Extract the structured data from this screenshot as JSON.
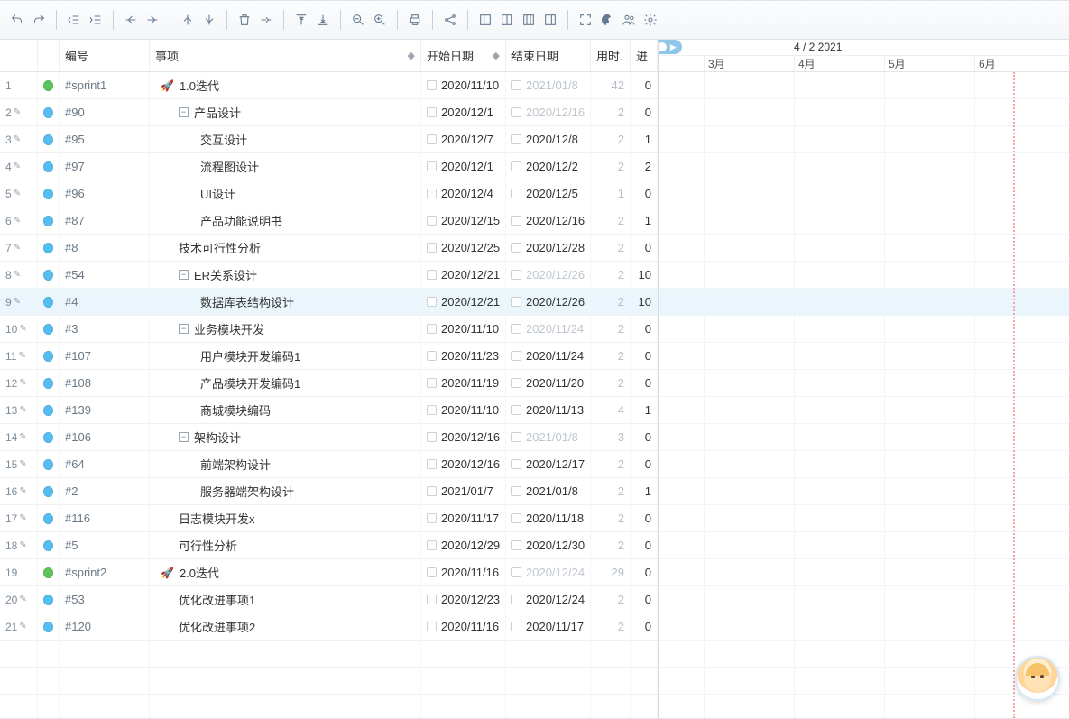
{
  "timeline": {
    "current_label": "4 / 2 2021",
    "months": [
      "3月",
      "4月",
      "5月",
      "6月"
    ]
  },
  "columns": {
    "num": "",
    "id": "编号",
    "name": "事项",
    "start": "开始日期",
    "end": "结束日期",
    "dur": "用时.",
    "prog": "进"
  },
  "rows": [
    {
      "n": "1",
      "edit": false,
      "dot": "green",
      "id": "#sprint1",
      "indent": 0,
      "icon": "rocket",
      "exp": null,
      "name": "1.0迭代",
      "start": "2020/11/10",
      "sFade": false,
      "end": "2021/01/8",
      "eFade": true,
      "dur": "42",
      "prog": "0"
    },
    {
      "n": "2",
      "edit": true,
      "dot": "blue",
      "id": "#90",
      "indent": 1,
      "icon": null,
      "exp": "-",
      "name": "产品设计",
      "start": "2020/12/1",
      "sFade": false,
      "end": "2020/12/16",
      "eFade": true,
      "dur": "2",
      "prog": "0"
    },
    {
      "n": "3",
      "edit": true,
      "dot": "blue",
      "id": "#95",
      "indent": 2,
      "icon": null,
      "exp": null,
      "name": "交互设计",
      "start": "2020/12/7",
      "sFade": false,
      "end": "2020/12/8",
      "eFade": false,
      "dur": "2",
      "prog": "1"
    },
    {
      "n": "4",
      "edit": true,
      "dot": "blue",
      "id": "#97",
      "indent": 2,
      "icon": null,
      "exp": null,
      "name": "流程图设计",
      "start": "2020/12/1",
      "sFade": false,
      "end": "2020/12/2",
      "eFade": false,
      "dur": "2",
      "prog": "2"
    },
    {
      "n": "5",
      "edit": true,
      "dot": "blue",
      "id": "#96",
      "indent": 2,
      "icon": null,
      "exp": null,
      "name": "UI设计",
      "start": "2020/12/4",
      "sFade": false,
      "end": "2020/12/5",
      "eFade": false,
      "dur": "1",
      "prog": "0"
    },
    {
      "n": "6",
      "edit": true,
      "dot": "blue",
      "id": "#87",
      "indent": 2,
      "icon": null,
      "exp": null,
      "name": "产品功能说明书",
      "start": "2020/12/15",
      "sFade": false,
      "end": "2020/12/16",
      "eFade": false,
      "dur": "2",
      "prog": "1"
    },
    {
      "n": "7",
      "edit": true,
      "dot": "blue",
      "id": "#8",
      "indent": 1,
      "icon": null,
      "exp": null,
      "name": "技术可行性分析",
      "start": "2020/12/25",
      "sFade": false,
      "end": "2020/12/28",
      "eFade": false,
      "dur": "2",
      "prog": "0"
    },
    {
      "n": "8",
      "edit": true,
      "dot": "blue",
      "id": "#54",
      "indent": 1,
      "icon": null,
      "exp": "-",
      "name": "ER关系设计",
      "start": "2020/12/21",
      "sFade": false,
      "end": "2020/12/26",
      "eFade": true,
      "dur": "2",
      "prog": "10"
    },
    {
      "n": "9",
      "edit": true,
      "dot": "blue",
      "id": "#4",
      "indent": 2,
      "icon": null,
      "exp": null,
      "name": "数据库表结构设计",
      "start": "2020/12/21",
      "sFade": false,
      "end": "2020/12/26",
      "eFade": false,
      "dur": "2",
      "prog": "10",
      "sel": true
    },
    {
      "n": "10",
      "edit": true,
      "dot": "blue",
      "id": "#3",
      "indent": 1,
      "icon": null,
      "exp": "-",
      "name": "业务模块开发",
      "start": "2020/11/10",
      "sFade": false,
      "end": "2020/11/24",
      "eFade": true,
      "dur": "2",
      "prog": "0"
    },
    {
      "n": "11",
      "edit": true,
      "dot": "blue",
      "id": "#107",
      "indent": 2,
      "icon": null,
      "exp": null,
      "name": "用户模块开发编码1",
      "start": "2020/11/23",
      "sFade": false,
      "end": "2020/11/24",
      "eFade": false,
      "dur": "2",
      "prog": "0"
    },
    {
      "n": "12",
      "edit": true,
      "dot": "blue",
      "id": "#108",
      "indent": 2,
      "icon": null,
      "exp": null,
      "name": "产品模块开发编码1",
      "start": "2020/11/19",
      "sFade": false,
      "end": "2020/11/20",
      "eFade": false,
      "dur": "2",
      "prog": "0"
    },
    {
      "n": "13",
      "edit": true,
      "dot": "blue",
      "id": "#139",
      "indent": 2,
      "icon": null,
      "exp": null,
      "name": "商城模块编码",
      "start": "2020/11/10",
      "sFade": false,
      "end": "2020/11/13",
      "eFade": false,
      "dur": "4",
      "prog": "1"
    },
    {
      "n": "14",
      "edit": true,
      "dot": "blue",
      "id": "#106",
      "indent": 1,
      "icon": null,
      "exp": "-",
      "name": "架构设计",
      "start": "2020/12/16",
      "sFade": false,
      "end": "2021/01/8",
      "eFade": true,
      "dur": "3",
      "prog": "0"
    },
    {
      "n": "15",
      "edit": true,
      "dot": "blue",
      "id": "#64",
      "indent": 2,
      "icon": null,
      "exp": null,
      "name": "前端架构设计",
      "start": "2020/12/16",
      "sFade": false,
      "end": "2020/12/17",
      "eFade": false,
      "dur": "2",
      "prog": "0"
    },
    {
      "n": "16",
      "edit": true,
      "dot": "blue",
      "id": "#2",
      "indent": 2,
      "icon": null,
      "exp": null,
      "name": "服务器端架构设计",
      "start": "2021/01/7",
      "sFade": false,
      "end": "2021/01/8",
      "eFade": false,
      "dur": "2",
      "prog": "1"
    },
    {
      "n": "17",
      "edit": true,
      "dot": "blue",
      "id": "#116",
      "indent": 1,
      "icon": null,
      "exp": null,
      "name": "日志模块开发x",
      "start": "2020/11/17",
      "sFade": false,
      "end": "2020/11/18",
      "eFade": false,
      "dur": "2",
      "prog": "0"
    },
    {
      "n": "18",
      "edit": true,
      "dot": "blue",
      "id": "#5",
      "indent": 1,
      "icon": null,
      "exp": null,
      "name": "可行性分析",
      "start": "2020/12/29",
      "sFade": false,
      "end": "2020/12/30",
      "eFade": false,
      "dur": "2",
      "prog": "0"
    },
    {
      "n": "19",
      "edit": false,
      "dot": "green",
      "id": "#sprint2",
      "indent": 0,
      "icon": "rocket",
      "exp": null,
      "name": "2.0迭代",
      "start": "2020/11/16",
      "sFade": false,
      "end": "2020/12/24",
      "eFade": true,
      "dur": "29",
      "prog": "0"
    },
    {
      "n": "20",
      "edit": true,
      "dot": "blue",
      "id": "#53",
      "indent": 1,
      "icon": null,
      "exp": null,
      "name": "优化改进事项1",
      "start": "2020/12/23",
      "sFade": false,
      "end": "2020/12/24",
      "eFade": false,
      "dur": "2",
      "prog": "0"
    },
    {
      "n": "21",
      "edit": true,
      "dot": "blue",
      "id": "#120",
      "indent": 1,
      "icon": null,
      "exp": null,
      "name": "优化改进事项2",
      "start": "2020/11/16",
      "sFade": false,
      "end": "2020/11/17",
      "eFade": false,
      "dur": "2",
      "prog": "0"
    }
  ]
}
